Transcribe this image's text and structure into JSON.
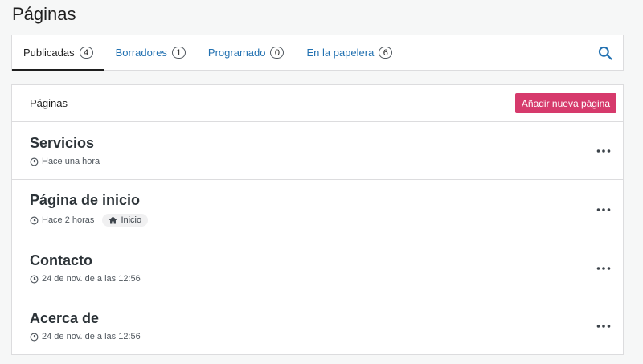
{
  "page": {
    "title": "Páginas"
  },
  "tabs": [
    {
      "label": "Publicadas",
      "count": "4"
    },
    {
      "label": "Borradores",
      "count": "1"
    },
    {
      "label": "Programado",
      "count": "0"
    },
    {
      "label": "En la papelera",
      "count": "6"
    }
  ],
  "list": {
    "header_label": "Páginas",
    "add_button_label": "Añadir nueva página",
    "rows": [
      {
        "title": "Servicios",
        "time": "Hace una hora"
      },
      {
        "title": "Página de inicio",
        "time": "Hace 2 horas",
        "badge": "Inicio"
      },
      {
        "title": "Contacto",
        "time": "24 de nov. de a las 12:56"
      },
      {
        "title": "Acerca de",
        "time": "24 de nov. de a las 12:56"
      }
    ]
  },
  "colors": {
    "accent": "#2271b1",
    "primary_button": "#d63a6c",
    "background": "#f6f7f7"
  },
  "icons": {
    "search": "search-icon",
    "clock": "clock-icon",
    "home": "home-icon",
    "more": "ellipsis-icon"
  }
}
